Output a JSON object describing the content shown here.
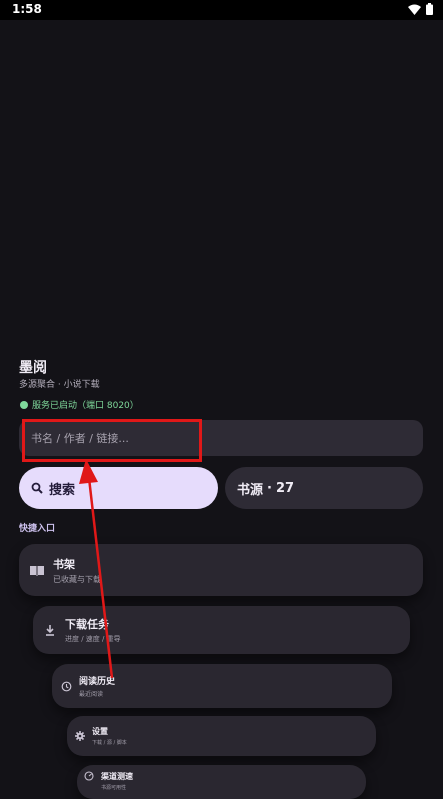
{
  "status_bar": {
    "time": "1:58"
  },
  "header": {
    "title": "墨阅",
    "subtitle": "多源聚合 · 小说下载",
    "server_status": "服务已启动（端口 8020）"
  },
  "search": {
    "placeholder": "书名 / 作者 / 链接...",
    "value": "",
    "button_label": "搜索"
  },
  "sources": {
    "label": "书源",
    "count": "27"
  },
  "quick_entry": {
    "title": "快捷入口",
    "items": [
      {
        "title": "书架",
        "subtitle": "已收藏与下载",
        "icon": "book-icon"
      },
      {
        "title": "下载任务",
        "subtitle": "进度 / 速度 / 重导",
        "icon": "download-icon"
      },
      {
        "title": "阅读历史",
        "subtitle": "最近阅读",
        "icon": "history-icon"
      },
      {
        "title": "设置",
        "subtitle": "下载 / 源 / 脚本",
        "icon": "gear-icon"
      },
      {
        "title": "渠道测速",
        "subtitle": "书源可用性",
        "icon": "speedometer-icon"
      }
    ]
  },
  "colors": {
    "background": "#131217",
    "card": "#2a2730",
    "accent": "#e6dcfc",
    "status_ok": "#7fd89b",
    "annotation": "#e01818"
  }
}
